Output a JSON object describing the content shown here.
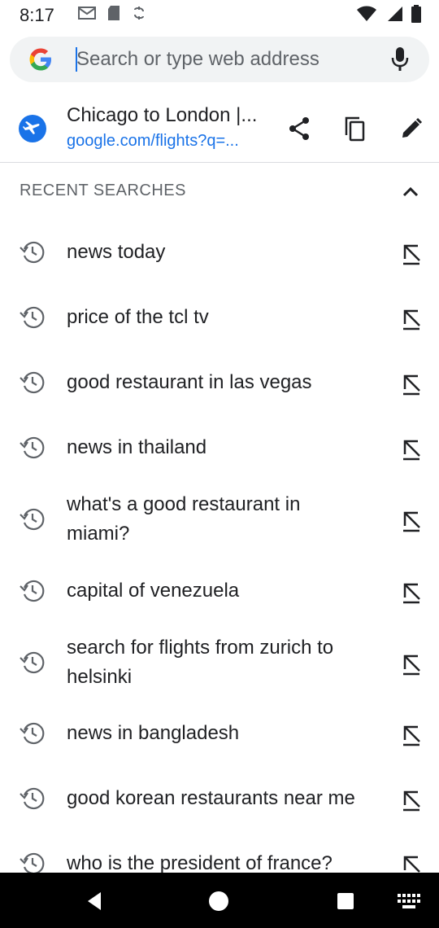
{
  "status_bar": {
    "time": "8:17"
  },
  "omnibox": {
    "placeholder": "Search or type web address",
    "value": ""
  },
  "top_suggestion": {
    "title": "Chicago to London |...",
    "url": "google.com/flights?q=..."
  },
  "recent_searches": {
    "header": "RECENT SEARCHES",
    "items": [
      {
        "label": "news today"
      },
      {
        "label": "price of the tcl tv"
      },
      {
        "label": "good restaurant in las vegas"
      },
      {
        "label": "news in thailand"
      },
      {
        "label": "what's a good restaurant in miami?"
      },
      {
        "label": "capital of venezuela"
      },
      {
        "label": "search for flights from zurich to helsinki"
      },
      {
        "label": "news in bangladesh"
      },
      {
        "label": "good korean restaurants near me"
      },
      {
        "label": "who is the president of france?"
      }
    ]
  },
  "icons": {
    "google": "google-g-icon",
    "mic": "mic-icon",
    "plane": "flight-icon",
    "share": "share-icon",
    "copy": "copy-icon",
    "edit": "edit-icon",
    "collapse": "chevron-up-icon",
    "history": "history-icon",
    "insert": "arrow-up-left-icon"
  },
  "colors": {
    "accent": "#1a73e8",
    "omnibox_bg": "#f1f3f4",
    "text_secondary": "#5f6368"
  }
}
